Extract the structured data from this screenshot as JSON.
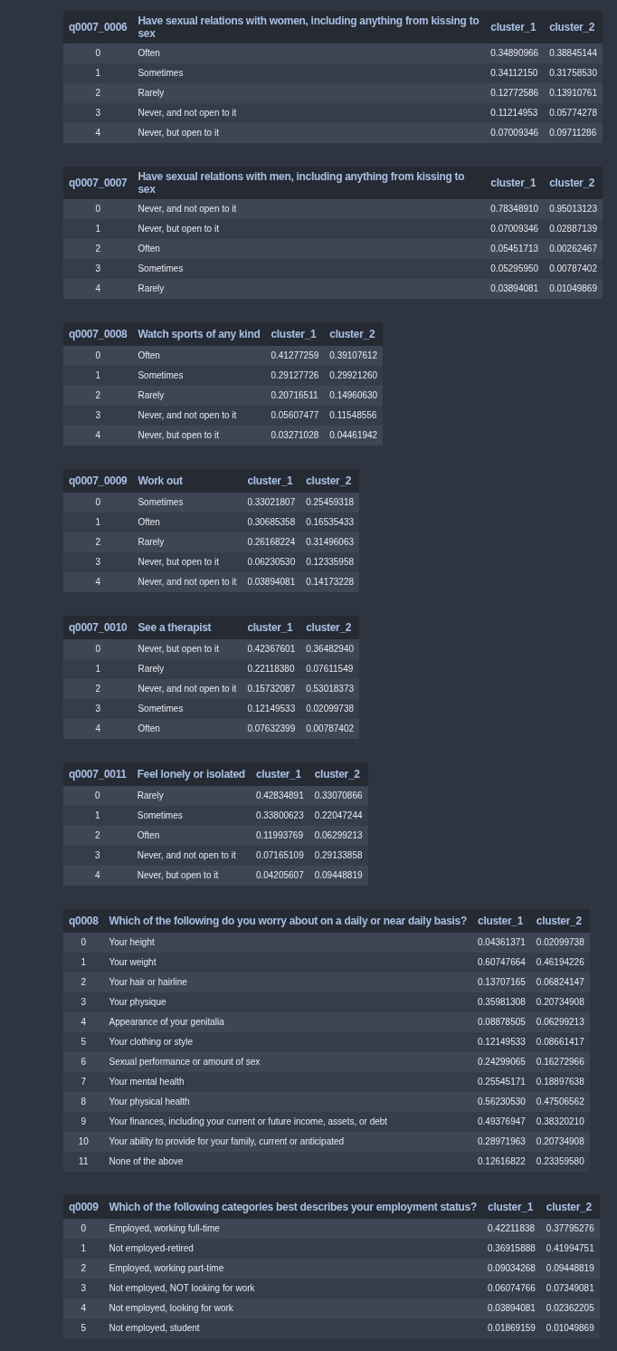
{
  "tables": [
    {
      "index_label": "q0007_0006",
      "question": "Have sexual relations with women, including anything from kissing to sex",
      "columns": [
        "cluster_1",
        "cluster_2"
      ],
      "rows": [
        {
          "index": "0",
          "answer": "Often",
          "values": [
            "0.34890966",
            "0.38845144"
          ]
        },
        {
          "index": "1",
          "answer": "Sometimes",
          "values": [
            "0.34112150",
            "0.31758530"
          ]
        },
        {
          "index": "2",
          "answer": "Rarely",
          "values": [
            "0.12772586",
            "0.13910761"
          ]
        },
        {
          "index": "3",
          "answer": "Never, and not open to it",
          "values": [
            "0.11214953",
            "0.05774278"
          ]
        },
        {
          "index": "4",
          "answer": "Never, but open to it",
          "values": [
            "0.07009346",
            "0.09711286"
          ]
        }
      ]
    },
    {
      "index_label": "q0007_0007",
      "question": "Have sexual relations with men, including anything from kissing to sex",
      "columns": [
        "cluster_1",
        "cluster_2"
      ],
      "rows": [
        {
          "index": "0",
          "answer": "Never, and not open to it",
          "values": [
            "0.78348910",
            "0.95013123"
          ]
        },
        {
          "index": "1",
          "answer": "Never, but open to it",
          "values": [
            "0.07009346",
            "0.02887139"
          ]
        },
        {
          "index": "2",
          "answer": "Often",
          "values": [
            "0.05451713",
            "0.00262467"
          ]
        },
        {
          "index": "3",
          "answer": "Sometimes",
          "values": [
            "0.05295950",
            "0.00787402"
          ]
        },
        {
          "index": "4",
          "answer": "Rarely",
          "values": [
            "0.03894081",
            "0.01049869"
          ]
        }
      ]
    },
    {
      "index_label": "q0007_0008",
      "question": "Watch sports of any kind",
      "columns": [
        "cluster_1",
        "cluster_2"
      ],
      "rows": [
        {
          "index": "0",
          "answer": "Often",
          "values": [
            "0.41277259",
            "0.39107612"
          ]
        },
        {
          "index": "1",
          "answer": "Sometimes",
          "values": [
            "0.29127726",
            "0.29921260"
          ]
        },
        {
          "index": "2",
          "answer": "Rarely",
          "values": [
            "0.20716511",
            "0.14960630"
          ]
        },
        {
          "index": "3",
          "answer": "Never, and not open to it",
          "values": [
            "0.05607477",
            "0.11548556"
          ]
        },
        {
          "index": "4",
          "answer": "Never, but open to it",
          "values": [
            "0.03271028",
            "0.04461942"
          ]
        }
      ]
    },
    {
      "index_label": "q0007_0009",
      "question": "Work out",
      "columns": [
        "cluster_1",
        "cluster_2"
      ],
      "rows": [
        {
          "index": "0",
          "answer": "Sometimes",
          "values": [
            "0.33021807",
            "0.25459318"
          ]
        },
        {
          "index": "1",
          "answer": "Often",
          "values": [
            "0.30685358",
            "0.16535433"
          ]
        },
        {
          "index": "2",
          "answer": "Rarely",
          "values": [
            "0.26168224",
            "0.31496063"
          ]
        },
        {
          "index": "3",
          "answer": "Never, but open to it",
          "values": [
            "0.06230530",
            "0.12335958"
          ]
        },
        {
          "index": "4",
          "answer": "Never, and not open to it",
          "values": [
            "0.03894081",
            "0.14173228"
          ]
        }
      ]
    },
    {
      "index_label": "q0007_0010",
      "question": "See a therapist",
      "columns": [
        "cluster_1",
        "cluster_2"
      ],
      "rows": [
        {
          "index": "0",
          "answer": "Never, but open to it",
          "values": [
            "0.42367601",
            "0.36482940"
          ]
        },
        {
          "index": "1",
          "answer": "Rarely",
          "values": [
            "0.22118380",
            "0.07611549"
          ]
        },
        {
          "index": "2",
          "answer": "Never, and not open to it",
          "values": [
            "0.15732087",
            "0.53018373"
          ]
        },
        {
          "index": "3",
          "answer": "Sometimes",
          "values": [
            "0.12149533",
            "0.02099738"
          ]
        },
        {
          "index": "4",
          "answer": "Often",
          "values": [
            "0.07632399",
            "0.00787402"
          ]
        }
      ]
    },
    {
      "index_label": "q0007_0011",
      "question": "Feel lonely or isolated",
      "columns": [
        "cluster_1",
        "cluster_2"
      ],
      "rows": [
        {
          "index": "0",
          "answer": "Rarely",
          "values": [
            "0.42834891",
            "0.33070866"
          ]
        },
        {
          "index": "1",
          "answer": "Sometimes",
          "values": [
            "0.33800623",
            "0.22047244"
          ]
        },
        {
          "index": "2",
          "answer": "Often",
          "values": [
            "0.11993769",
            "0.06299213"
          ]
        },
        {
          "index": "3",
          "answer": "Never, and not open to it",
          "values": [
            "0.07165109",
            "0.29133858"
          ]
        },
        {
          "index": "4",
          "answer": "Never, but open to it",
          "values": [
            "0.04205607",
            "0.09448819"
          ]
        }
      ]
    },
    {
      "index_label": "q0008",
      "question": "Which of the following do you worry about on a daily or near daily basis?",
      "columns": [
        "cluster_1",
        "cluster_2"
      ],
      "rows": [
        {
          "index": "0",
          "answer": "Your height",
          "values": [
            "0.04361371",
            "0.02099738"
          ]
        },
        {
          "index": "1",
          "answer": "Your weight",
          "values": [
            "0.60747664",
            "0.46194226"
          ]
        },
        {
          "index": "2",
          "answer": "Your hair or hairline",
          "values": [
            "0.13707165",
            "0.06824147"
          ]
        },
        {
          "index": "3",
          "answer": "Your physique",
          "values": [
            "0.35981308",
            "0.20734908"
          ]
        },
        {
          "index": "4",
          "answer": "Appearance of your genitalia",
          "values": [
            "0.08878505",
            "0.06299213"
          ]
        },
        {
          "index": "5",
          "answer": "Your clothing or style",
          "values": [
            "0.12149533",
            "0.08661417"
          ]
        },
        {
          "index": "6",
          "answer": "Sexual performance or amount of sex",
          "values": [
            "0.24299065",
            "0.16272966"
          ]
        },
        {
          "index": "7",
          "answer": "Your mental health",
          "values": [
            "0.25545171",
            "0.18897638"
          ]
        },
        {
          "index": "8",
          "answer": "Your physical health",
          "values": [
            "0.56230530",
            "0.47506562"
          ]
        },
        {
          "index": "9",
          "answer": "Your finances, including your current or future income, assets, or debt",
          "values": [
            "0.49376947",
            "0.38320210"
          ]
        },
        {
          "index": "10",
          "answer": "Your ability to provide for your family, current or anticipated",
          "values": [
            "0.28971963",
            "0.20734908"
          ]
        },
        {
          "index": "11",
          "answer": "None of the above",
          "values": [
            "0.12616822",
            "0.23359580"
          ]
        }
      ]
    },
    {
      "index_label": "q0009",
      "question": "Which of the following categories best describes your employment status?",
      "columns": [
        "cluster_1",
        "cluster_2"
      ],
      "rows": [
        {
          "index": "0",
          "answer": "Employed, working full-time",
          "values": [
            "0.42211838",
            "0.37795276"
          ]
        },
        {
          "index": "1",
          "answer": "Not employed-retired",
          "values": [
            "0.36915888",
            "0.41994751"
          ]
        },
        {
          "index": "2",
          "answer": "Employed, working part-time",
          "values": [
            "0.09034268",
            "0.09448819"
          ]
        },
        {
          "index": "3",
          "answer": "Not employed, NOT looking for work",
          "values": [
            "0.06074766",
            "0.07349081"
          ]
        },
        {
          "index": "4",
          "answer": "Not employed, looking for work",
          "values": [
            "0.03894081",
            "0.02362205"
          ]
        },
        {
          "index": "5",
          "answer": "Not employed, student",
          "values": [
            "0.01869159",
            "0.01049869"
          ]
        }
      ]
    }
  ]
}
